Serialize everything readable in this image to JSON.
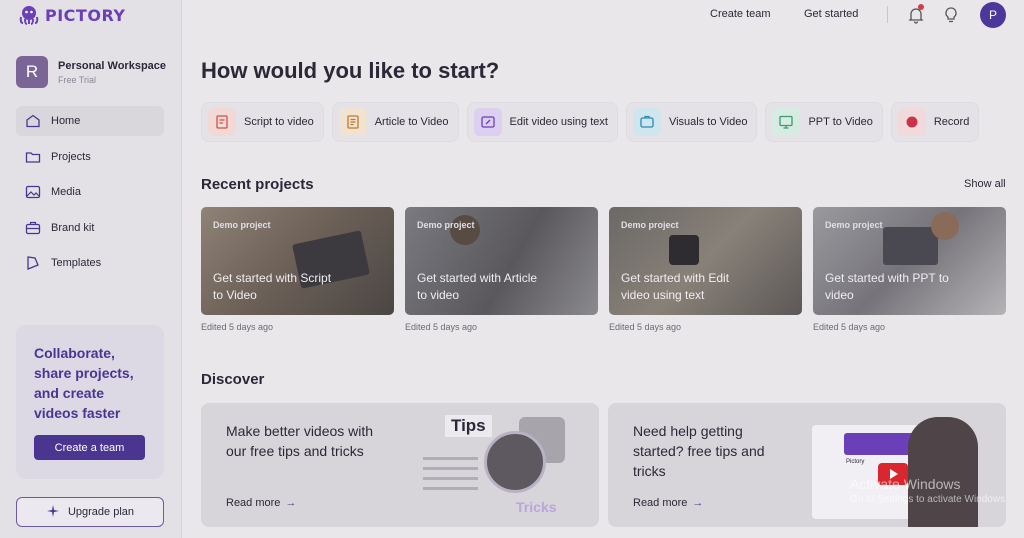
{
  "app": {
    "name": "PICTORY"
  },
  "workspace": {
    "initial": "R",
    "name": "Personal Workspace",
    "plan": "Free Trial"
  },
  "nav": [
    {
      "label": "Home",
      "icon": "home-icon"
    },
    {
      "label": "Projects",
      "icon": "folder-icon"
    },
    {
      "label": "Media",
      "icon": "image-icon"
    },
    {
      "label": "Brand kit",
      "icon": "briefcase-icon"
    },
    {
      "label": "Templates",
      "icon": "template-icon"
    }
  ],
  "collab": {
    "text": "Collaborate, share projects, and create videos faster",
    "button": "Create a team"
  },
  "upgrade": {
    "label": "Upgrade plan",
    "icon": "sparkle-icon"
  },
  "topbar": {
    "create_team": "Create team",
    "get_started": "Get started",
    "avatar_initial": "P"
  },
  "main": {
    "headline": "How would you like to start?",
    "start_options": [
      {
        "label": "Script to video",
        "icon": "script-icon"
      },
      {
        "label": "Article to Video",
        "icon": "article-icon"
      },
      {
        "label": "Edit video using text",
        "icon": "edit-text-icon"
      },
      {
        "label": "Visuals to Video",
        "icon": "visuals-icon"
      },
      {
        "label": "PPT to Video",
        "icon": "ppt-icon"
      },
      {
        "label": "Record",
        "icon": "record-icon"
      }
    ],
    "recent_title": "Recent projects",
    "show_all": "Show all",
    "projects": [
      {
        "tag": "Demo project",
        "caption": "Get started with Script to Video",
        "edited": "Edited 5 days ago"
      },
      {
        "tag": "Demo project",
        "caption": "Get started with Article to video",
        "edited": "Edited 5 days ago"
      },
      {
        "tag": "Demo project",
        "caption": "Get started with Edit video using text",
        "edited": "Edited 5 days ago"
      },
      {
        "tag": "Demo project",
        "caption": "Get started with PPT to video",
        "edited": "Edited 5 days ago"
      }
    ],
    "discover_title": "Discover",
    "discover": [
      {
        "title": "Make better videos with our free tips and tricks",
        "read_more": "Read more",
        "art_text_1": "Tips",
        "art_text_2": "Tricks"
      },
      {
        "title": "Need help getting started? free tips and tricks",
        "read_more": "Read more",
        "art_text_1": "Pictory"
      }
    ]
  },
  "watermark": {
    "line1": "Activate Windows",
    "line2": "Go to Settings to activate Windows."
  },
  "colors": {
    "brand": "#4a3591",
    "logo": "#6a3fb8",
    "notification": "#d53a4a"
  }
}
